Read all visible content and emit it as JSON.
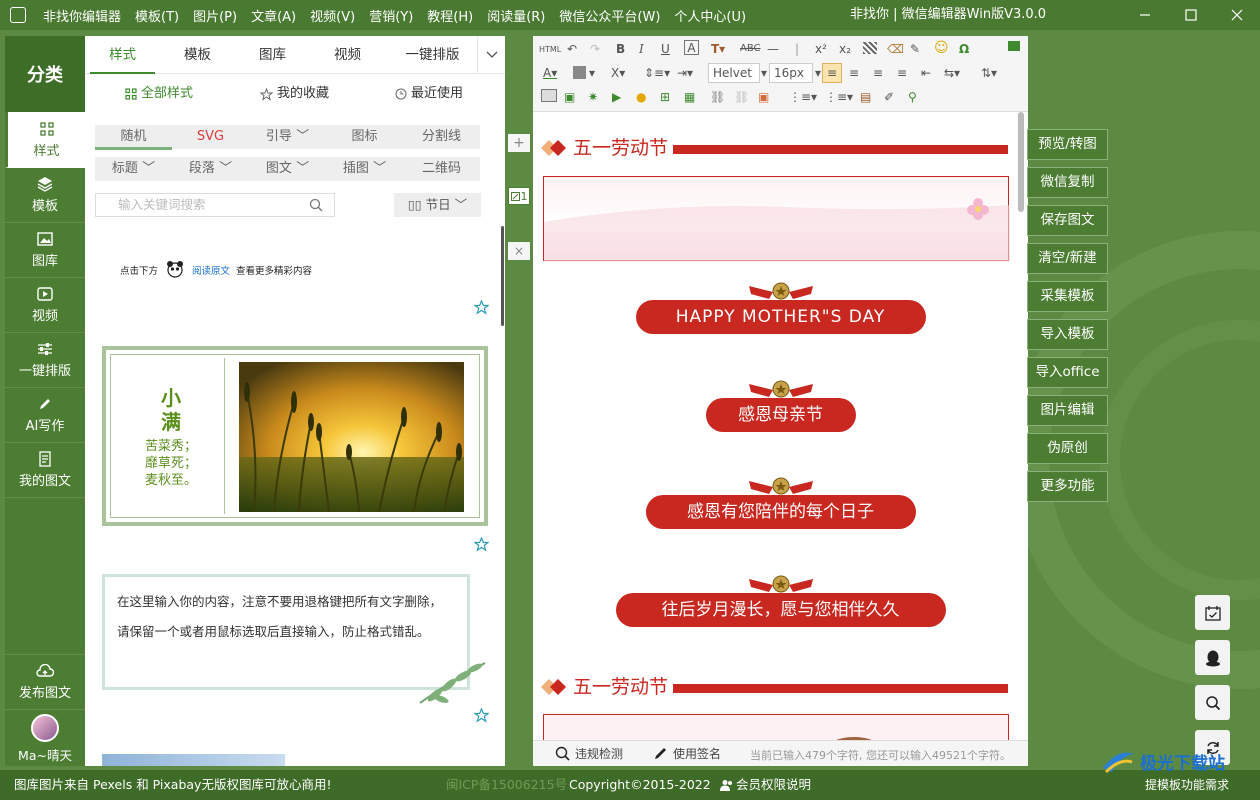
{
  "window": {
    "title": "非找你 | 微信编辑器Win版V3.0.0",
    "menu": [
      "非找你编辑器",
      "模板(T)",
      "图片(P)",
      "文章(A)",
      "视频(V)",
      "营销(Y)",
      "教程(H)",
      "阅读量(R)",
      "微信公众平台(W)",
      "个人中心(U)"
    ]
  },
  "leftnav": {
    "header": "分类",
    "items": [
      {
        "label": "样式",
        "icon": "grid-icon"
      },
      {
        "label": "模板",
        "icon": "layers-icon"
      },
      {
        "label": "图库",
        "icon": "image-icon"
      },
      {
        "label": "视频",
        "icon": "video-icon"
      },
      {
        "label": "一键排版",
        "icon": "sliders-icon"
      },
      {
        "label": "AI写作",
        "icon": "pen-icon"
      },
      {
        "label": "我的图文",
        "icon": "document-icon"
      }
    ],
    "publish": "发布图文",
    "user": "Ma~晴天"
  },
  "library": {
    "tabs": [
      "样式",
      "模板",
      "图库",
      "视频",
      "一键排版"
    ],
    "subtabs": [
      "全部样式",
      "我的收藏",
      "最近使用"
    ],
    "chips_row1": [
      "随机",
      "SVG",
      "引导",
      "图标",
      "分割线"
    ],
    "chips_row2": [
      "标题",
      "段落",
      "图文",
      "插图",
      "二维码"
    ],
    "search_placeholder": "输入关键词搜索",
    "festival": "节日",
    "card1": {
      "prefix": "点击下方",
      "link": "阅读原文",
      "suffix": "查看更多精彩内容"
    },
    "card2": {
      "title1": "小",
      "title2": "满",
      "lines": [
        "苦菜秀；",
        "靡草死；",
        "麦秋至。"
      ]
    },
    "card3": {
      "text": "在这里输入你的内容，注意不要用退格键把所有文字删除，请保留一个或者用鼠标选取后直接输入，防止格式错乱。"
    }
  },
  "editor": {
    "toolbar": {
      "html": "HTML",
      "font": "Helvet",
      "size": "16px"
    },
    "side_badge": "1",
    "section_title": "五一劳动节",
    "pills": [
      "HAPPY MOTHER\"S DAY",
      "感恩母亲节",
      "感恩有您陪伴的每个日子",
      "往后岁月漫长，愿与您相伴久久"
    ],
    "status": {
      "check": "违规检测",
      "sign": "使用签名",
      "count": "当前已输入479个字符, 您还可以输入49521个字符。"
    }
  },
  "right_buttons": [
    "预览/转图",
    "微信复制",
    "保存图文",
    "清空/新建",
    "采集模板",
    "导入模板",
    "导入office",
    "图片编辑",
    "伪原创",
    "更多功能"
  ],
  "footer": {
    "left": "图库图片来自 Pexels 和 Pixabay无版权图库可放心商用!",
    "icp": "闽ICP备15006215号",
    "copyright": "Copyright©2015-2022",
    "member": "会员权限说明",
    "feedback": "提模板功能需求",
    "watermark": "极光下载站"
  },
  "colors": {
    "accent": "#4c7d33",
    "red": "#c8281f",
    "green_text": "#3e8a2e"
  }
}
